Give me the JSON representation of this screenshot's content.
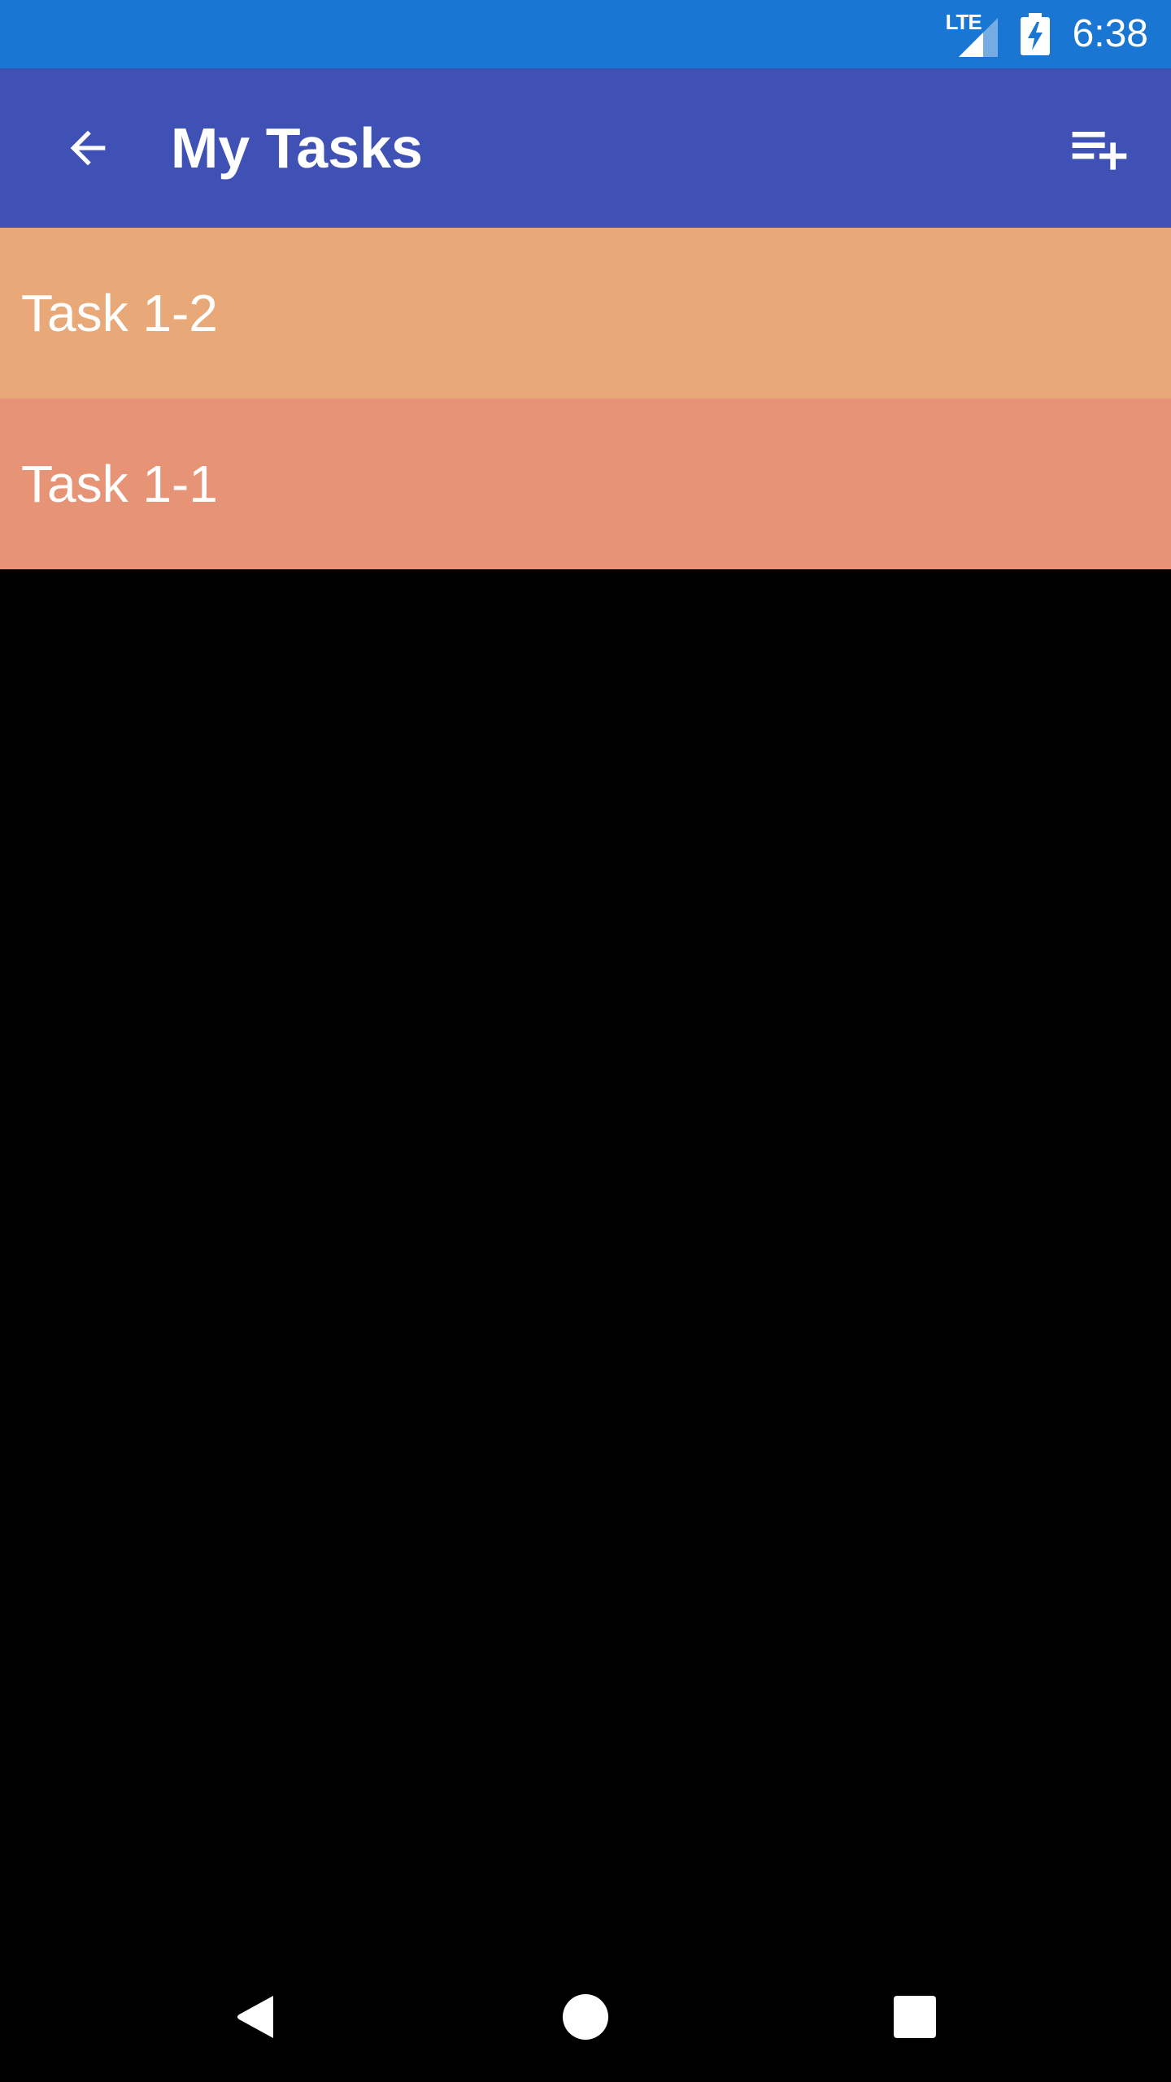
{
  "status_bar": {
    "network_label": "LTE",
    "time": "6:38",
    "background_color": "#1976D2",
    "icons": [
      "signal-icon",
      "battery-charging-icon"
    ]
  },
  "app_bar": {
    "title": "My Tasks",
    "background_color": "#3F51B5",
    "back_icon": "arrow-back-icon",
    "action_icon": "playlist-add-icon"
  },
  "tasks": [
    {
      "label": "Task 1-2",
      "color": "#E8A878"
    },
    {
      "label": "Task 1-1",
      "color": "#E69376"
    }
  ],
  "nav_bar": {
    "icons": [
      "nav-back-icon",
      "nav-home-icon",
      "nav-recents-icon"
    ]
  }
}
